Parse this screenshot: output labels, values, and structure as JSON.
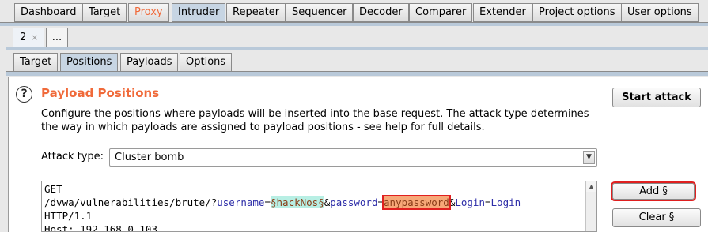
{
  "top_tabs": [
    "Dashboard",
    "Target",
    "Proxy",
    "Intruder",
    "Repeater",
    "Sequencer",
    "Decoder",
    "Comparer",
    "Extender",
    "Project options",
    "User options"
  ],
  "active_top_tab": "Intruder",
  "instance_tabs": {
    "current": "2",
    "close_glyph": "×",
    "more": "..."
  },
  "sub_tabs": [
    "Target",
    "Positions",
    "Payloads",
    "Options"
  ],
  "active_sub_tab": "Positions",
  "section": {
    "title": "Payload Positions",
    "help_glyph": "?",
    "description": "Configure the positions where payloads will be inserted into the base request. The attack type determines the way in which payloads are assigned to payload positions - see help for full details."
  },
  "buttons": {
    "start_attack": "Start attack",
    "add": "Add §",
    "clear": "Clear §"
  },
  "attack_type": {
    "label": "Attack type:",
    "value": "Cluster bomb"
  },
  "request": {
    "line1": "GET",
    "path_prefix": "/dvwa/vulnerabilities/brute/?",
    "param1": "username",
    "eq": "=",
    "marker1": "§hackNos§",
    "amp1": "&",
    "param2": "password",
    "marker2": "anypassword",
    "amp2": "&",
    "param3": "Login",
    "value3": "Login",
    "line3": "HTTP/1.1",
    "line4": "Host: 192.168.0.103"
  },
  "colors": {
    "accent": "#f06a3a",
    "active_tab": "#c7d5e3",
    "highlight_border": "#e02020"
  }
}
